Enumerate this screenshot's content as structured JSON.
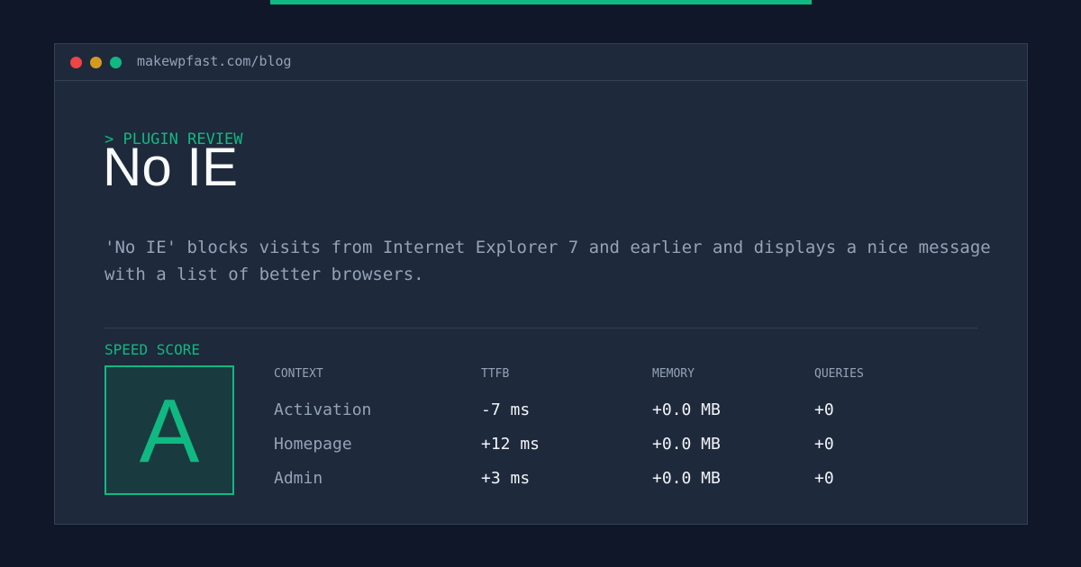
{
  "window": {
    "url": "makewpfast.com/blog"
  },
  "article": {
    "eyebrow": "> PLUGIN REVIEW",
    "title": "No IE",
    "description": "'No IE' blocks visits from Internet Explorer 7 and earlier and displays a nice message with a list of better browsers."
  },
  "score": {
    "label": "SPEED SCORE",
    "grade": "A"
  },
  "table": {
    "headers": [
      "CONTEXT",
      "TTFB",
      "MEMORY",
      "QUERIES"
    ],
    "rows": [
      {
        "context": "Activation",
        "ttfb": "-7 ms",
        "memory": "+0.0 MB",
        "queries": "+0"
      },
      {
        "context": "Homepage",
        "ttfb": "+12 ms",
        "memory": "+0.0 MB",
        "queries": "+0"
      },
      {
        "context": "Admin",
        "ttfb": "+3 ms",
        "memory": "+0.0 MB",
        "queries": "+0"
      }
    ]
  },
  "colors": {
    "background": "#0f1729",
    "panel": "#1e293b",
    "accent": "#10b981",
    "muted_text": "#94a3b8",
    "window_dot_red": "#ef4444",
    "window_dot_yellow": "#d49a1f",
    "window_dot_green": "#10b981"
  }
}
